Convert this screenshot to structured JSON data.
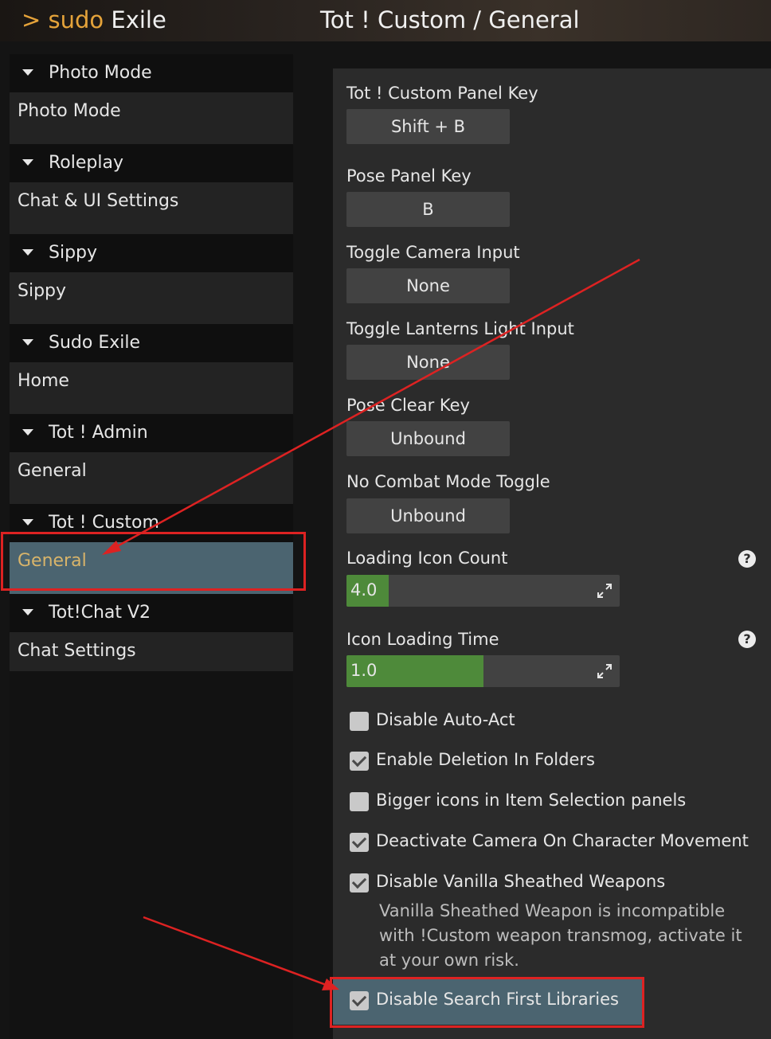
{
  "header": {
    "app_prefix": ">",
    "app_name_accent": "sudo",
    "app_name": "Exile",
    "page_title": "Tot ! Custom / General"
  },
  "sidebar": {
    "groups": [
      {
        "label": "Photo Mode",
        "item": "Photo Mode"
      },
      {
        "label": "Roleplay",
        "item": "Chat & UI Settings"
      },
      {
        "label": "Sippy",
        "item": "Sippy"
      },
      {
        "label": "Sudo Exile",
        "item": "Home"
      },
      {
        "label": "Tot ! Admin",
        "item": "General"
      },
      {
        "label": "Tot ! Custom",
        "item": "General",
        "selected": true
      },
      {
        "label": "Tot!Chat V2",
        "item": "Chat Settings"
      }
    ]
  },
  "settings": {
    "keys": [
      {
        "label": "Tot ! Custom Panel Key",
        "value": "Shift + B"
      },
      {
        "label": "Pose Panel Key",
        "value": "B"
      },
      {
        "label": "Toggle Camera Input",
        "value": "None"
      },
      {
        "label": "Toggle Lanterns Light Input",
        "value": "None"
      },
      {
        "label": "Pose Clear Key",
        "value": "Unbound"
      },
      {
        "label": "No Combat Mode Toggle",
        "value": "Unbound"
      }
    ],
    "sliders": [
      {
        "label": "Loading Icon Count",
        "value": "4.0",
        "fraction": 0.155
      },
      {
        "label": "Icon Loading Time",
        "value": "1.0",
        "fraction": 0.5
      }
    ],
    "help_glyph": "?",
    "checkboxes": [
      {
        "label": "Disable Auto-Act",
        "checked": false
      },
      {
        "label": "Enable Deletion In Folders",
        "checked": true
      },
      {
        "label": "Bigger icons in Item Selection panels",
        "checked": false
      },
      {
        "label": "Deactivate Camera On Character Movement",
        "checked": true
      },
      {
        "label": "Disable Vanilla Sheathed Weapons",
        "checked": true
      },
      {
        "label": "Disable Search First Libraries",
        "checked": true
      }
    ],
    "vanilla_description": "Vanilla Sheathed Weapon is incompatible with !Custom weapon transmog, activate it at your own risk."
  },
  "annotation_color": "#dd2222"
}
